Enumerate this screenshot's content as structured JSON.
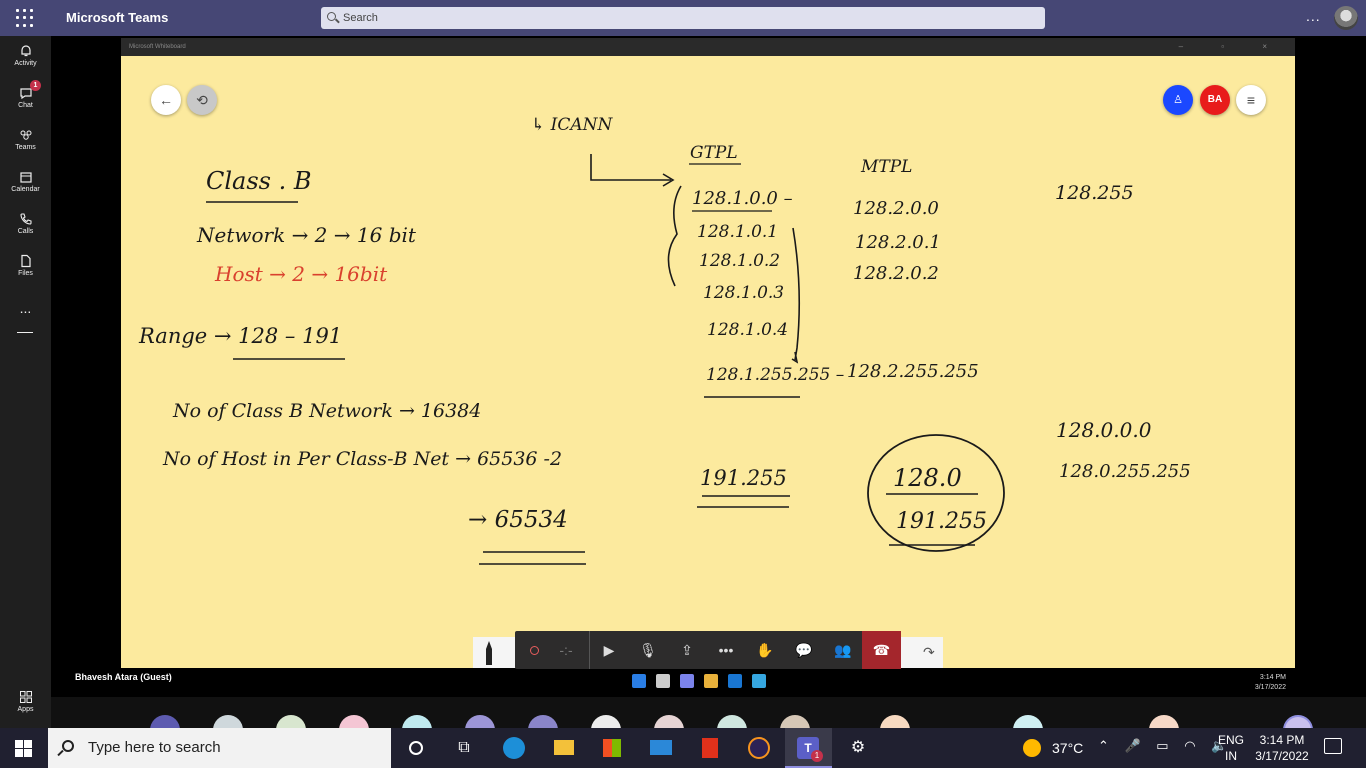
{
  "teams": {
    "app_title": "Microsoft Teams",
    "search_placeholder": "Search",
    "more_label": "...",
    "rail": [
      {
        "key": "activity",
        "label": "Activity"
      },
      {
        "key": "chat",
        "label": "Chat",
        "badge": "1"
      },
      {
        "key": "teams",
        "label": "Teams"
      },
      {
        "key": "calendar",
        "label": "Calendar"
      },
      {
        "key": "calls",
        "label": "Calls"
      },
      {
        "key": "files",
        "label": "Files"
      }
    ],
    "rail_more": "...",
    "apps_label": "Apps"
  },
  "whiteboard": {
    "window_title": "Microsoft Whiteboard",
    "participant_initials": "BA",
    "ink": {
      "icann": "↳ ICANN",
      "class_b": "Class . B",
      "network": "Network → 2 → 16 bit",
      "host": "Host → 2 → 16bit",
      "range": "Range → 128 – 191",
      "no_of_networks": "No of Class B Network → 16384",
      "no_of_hosts": "No of Host in Per Class-B Net → 65536 -2",
      "result": "→ 65534",
      "gtpl": "GTPL",
      "mtpl": "MTPL",
      "gtpl_ips": [
        "128.1.0.0 –",
        "128.1.0.1",
        "128.1.0.2",
        "128.1.0.3",
        "128.1.0.4",
        "128.1.255.255 –"
      ],
      "mtpl_ips": [
        "128.2.0.0",
        "128.2.0.1",
        "128.2.0.2",
        "128.2.255.255"
      ],
      "col3_top": "128.255",
      "col3_a": "128.0.0.0",
      "col3_b": "128.0.255.255",
      "range_mid": "191.255",
      "circle_top": "128.0",
      "circle_bottom": "191.255"
    }
  },
  "call": {
    "guest_name": "Bhavesh Atara (Guest)",
    "vm_time": "3:14 PM",
    "vm_date": "3/17/2022"
  },
  "taskbar": {
    "search_placeholder": "Type here to search",
    "teams_badge": "1",
    "temperature": "37°C",
    "lang_top": "ENG",
    "lang_bottom": "IN",
    "time": "3:14 PM",
    "date": "3/17/2022"
  },
  "colors": {
    "teams_header": "#464775",
    "whiteboard_bg": "#fcea9e",
    "ink_black": "#1a1a1a",
    "ink_red": "#d9412e",
    "hangup": "#a4262c"
  }
}
